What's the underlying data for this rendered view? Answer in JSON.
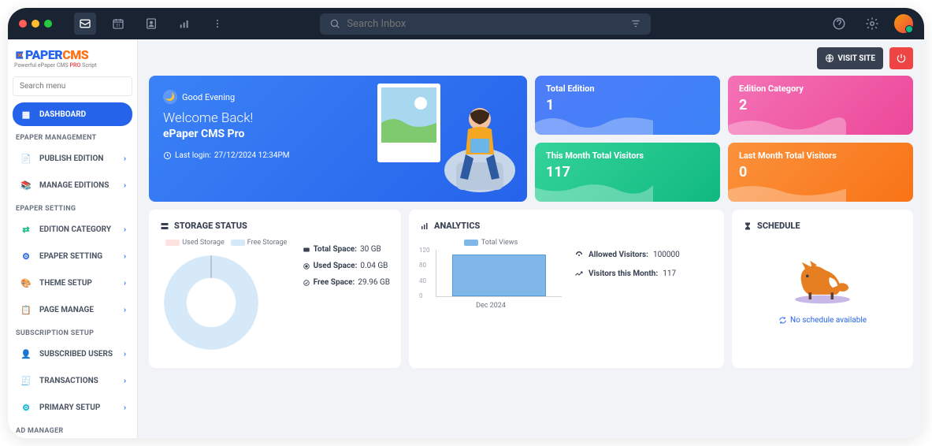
{
  "topbar": {
    "search_placeholder": "Search Inbox"
  },
  "logo": {
    "paper": "PAPER",
    "cms": "CMS",
    "sub_prefix": "Powerful ePaper CMS ",
    "sub_pro": "PRO",
    "sub_suffix": " Script"
  },
  "sidebar": {
    "search_placeholder": "Search menu",
    "dashboard": "DASHBOARD",
    "sections": {
      "epaper_mgmt": "EPAPER MANAGEMENT",
      "epaper_setting": "EPAPER SETTING",
      "subscription": "SUBSCRIPTION SETUP",
      "ad": "AD MANAGER"
    },
    "items": {
      "publish": "PUBLISH EDITION",
      "manage": "MANAGE EDITIONS",
      "category": "EDITION CATEGORY",
      "setting": "EPAPER SETTING",
      "theme": "THEME SETUP",
      "page": "PAGE MANAGE",
      "subscribed": "SUBSCRIBED USERS",
      "transactions": "TRANSACTIONS",
      "primary": "PRIMARY SETUP"
    }
  },
  "header": {
    "visit": "VISIT SITE"
  },
  "welcome": {
    "greeting": "Good Evening",
    "back": "Welcome Back!",
    "app": "ePaper CMS Pro",
    "login_prefix": "Last login: ",
    "login_time": "27/12/2024 12:34PM"
  },
  "stats": {
    "total_edition": {
      "label": "Total Edition",
      "value": "1"
    },
    "edition_category": {
      "label": "Edition Category",
      "value": "2"
    },
    "month_visitors": {
      "label": "This Month Total Visitors",
      "value": "117"
    },
    "last_month": {
      "label": "Last Month Total Visitors",
      "value": "0"
    }
  },
  "storage": {
    "title": "STORAGE STATUS",
    "legend_used": "Used Storage",
    "legend_free": "Free Storage",
    "total_label": "Total Space:",
    "total_value": " 30 GB",
    "used_label": "Used Space:",
    "used_value": " 0.04 GB",
    "free_label": "Free Space:",
    "free_value": " 29.96 GB"
  },
  "analytics": {
    "title": "ANALYTICS",
    "legend": "Total Views",
    "y": {
      "a": "120",
      "b": "80",
      "c": "40",
      "d": "0"
    },
    "x": "Dec 2024",
    "allowed_label": "Allowed Visitors:",
    "allowed_value": " 100000",
    "month_label": "Visitors this Month:",
    "month_value": " 117"
  },
  "schedule": {
    "title": "SCHEDULE",
    "empty": "No schedule available"
  },
  "chart_data": [
    {
      "type": "pie",
      "title": "STORAGE STATUS",
      "series": [
        {
          "name": "Used Storage",
          "value": 0.04,
          "color": "#fde2e2"
        },
        {
          "name": "Free Storage",
          "value": 29.96,
          "color": "#d6e9f8"
        }
      ],
      "total": 30,
      "unit": "GB"
    },
    {
      "type": "bar",
      "title": "ANALYTICS",
      "categories": [
        "Dec 2024"
      ],
      "series": [
        {
          "name": "Total Views",
          "values": [
            117
          ]
        }
      ],
      "ylabel": "",
      "ylim": [
        0,
        120
      ]
    }
  ]
}
